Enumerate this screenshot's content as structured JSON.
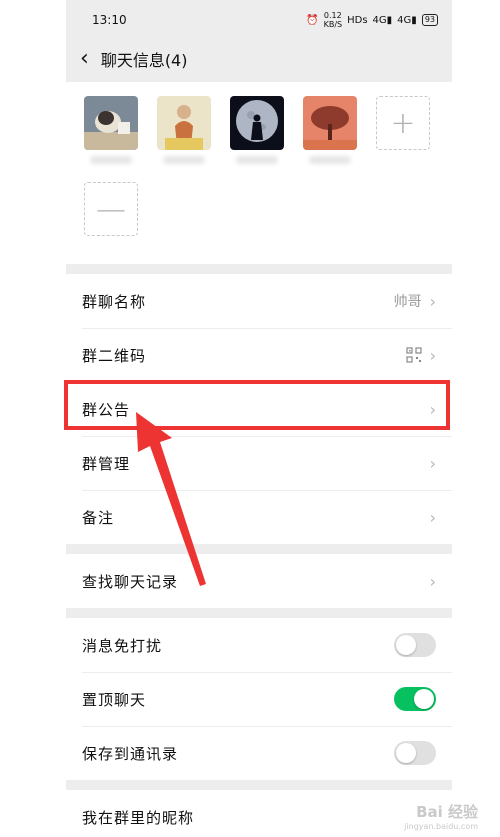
{
  "status": {
    "time": "13:10",
    "speed": "0.12",
    "speed_unit": "KB/S",
    "hd": "HDs",
    "signal1": "4G",
    "signal2": "4G",
    "battery": "93"
  },
  "header": {
    "title": "聊天信息(4)"
  },
  "members": [
    {
      "avatar": "avatar-dog"
    },
    {
      "avatar": "avatar-girl"
    },
    {
      "avatar": "avatar-moon"
    },
    {
      "avatar": "avatar-tree"
    }
  ],
  "settings": {
    "group_name_label": "群聊名称",
    "group_name_value": "帅哥",
    "qr_label": "群二维码",
    "notice_label": "群公告",
    "manage_label": "群管理",
    "remark_label": "备注",
    "search_history_label": "查找聊天记录",
    "mute_label": "消息免打扰",
    "pin_label": "置顶聊天",
    "save_contacts_label": "保存到通讯录",
    "nickname_label": "我在群里的昵称"
  },
  "toggles": {
    "mute": false,
    "pin": true,
    "save_contacts": false
  },
  "colors": {
    "accent": "#07c160",
    "highlight": "#ee3333"
  },
  "watermark": {
    "logo": "Bai 经验",
    "url": "jingyan.baidu.com"
  }
}
